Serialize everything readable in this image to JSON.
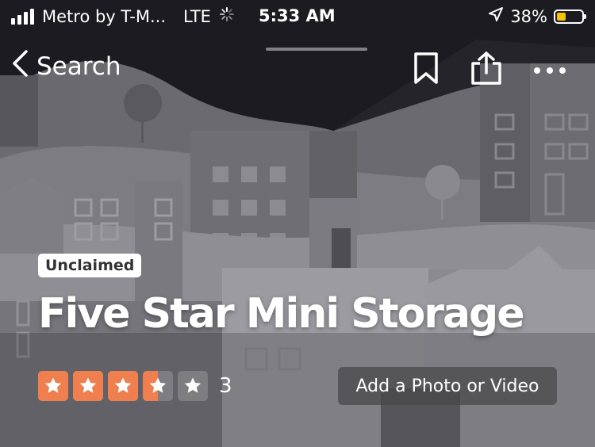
{
  "status_bar": {
    "carrier": "Metro by T-M...",
    "network": "LTE",
    "time": "5:33 AM",
    "battery_percent": "38%",
    "battery_level": 0.38,
    "battery_color": "#f5c400",
    "icons": [
      "signal-bars-icon",
      "loading-spinner-icon",
      "location-arrow-icon",
      "battery-icon"
    ]
  },
  "nav": {
    "back_label": "Search",
    "icons": [
      "chevron-left-icon",
      "bookmark-icon",
      "share-icon",
      "more-icon"
    ]
  },
  "business": {
    "badge": "Unclaimed",
    "name": "Five Star Mini Storage",
    "rating": 3.5,
    "max_rating": 5,
    "review_count": "3",
    "star_color": "#f07f4f"
  },
  "actions": {
    "add_media_label": "Add a Photo or Video"
  }
}
